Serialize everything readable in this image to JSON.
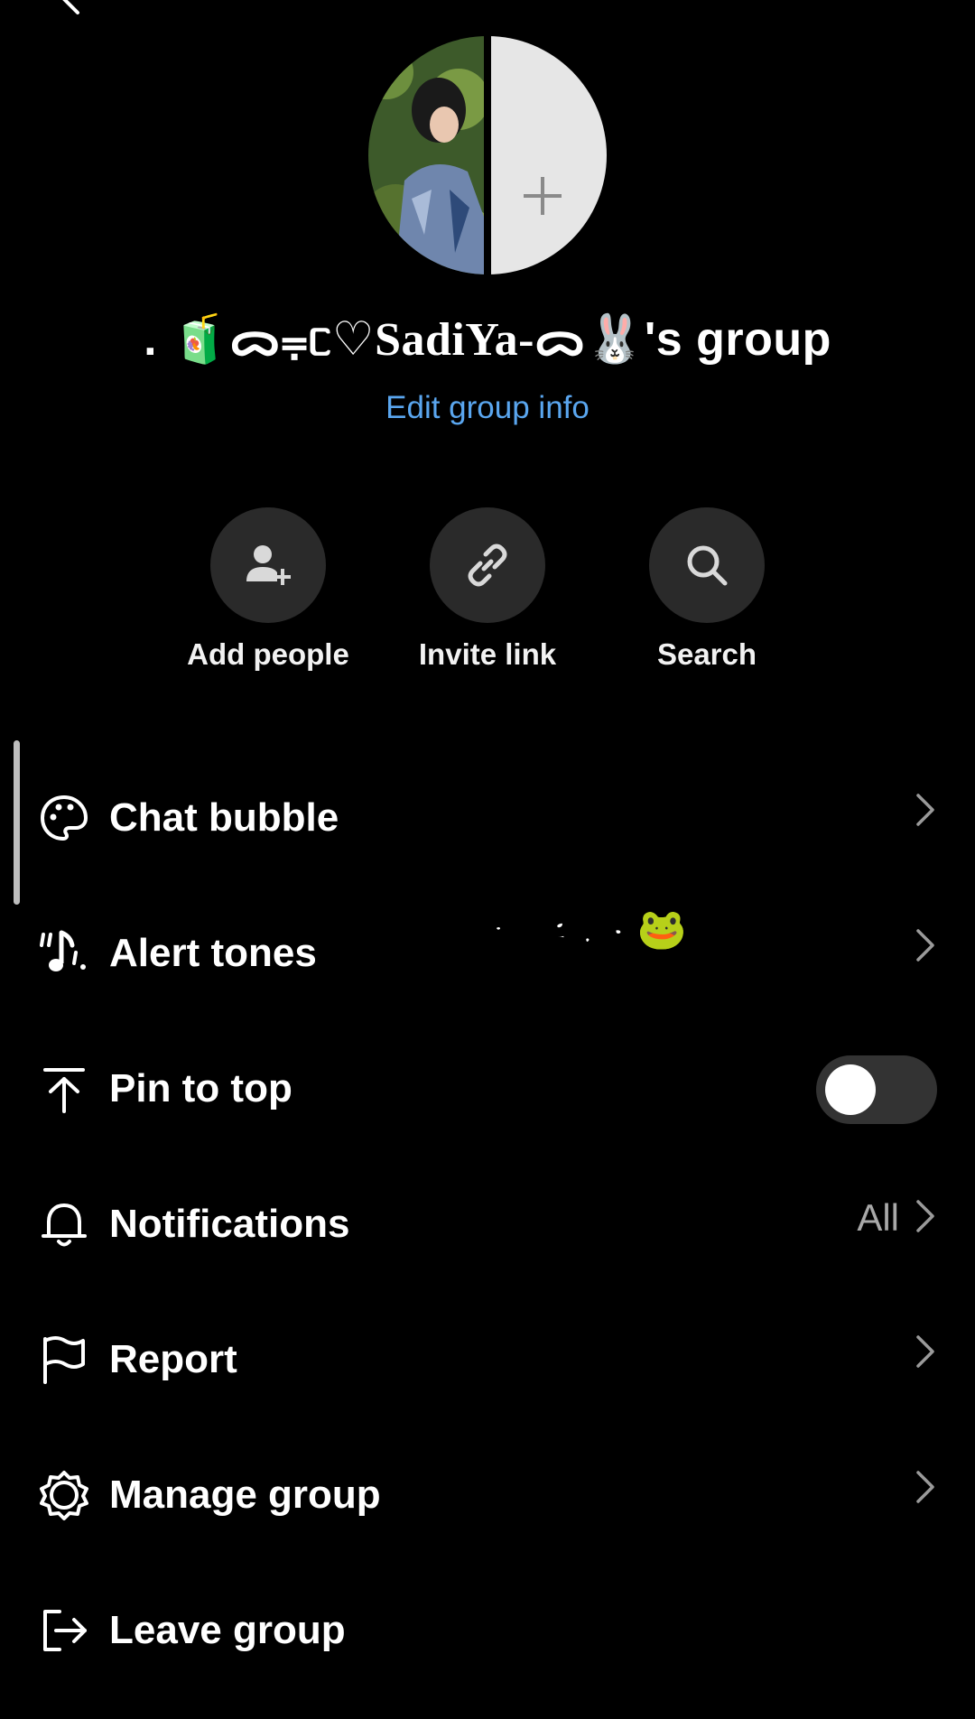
{
  "header": {
    "group_name_prefix": ". 🧃",
    "group_name_deco": "ᯅ⩦ᥴ♡",
    "group_name_core": "SadiYa-",
    "group_name_suffix": "ᯅ🐰",
    "group_name_tail": "'s group",
    "edit_label": "Edit group info"
  },
  "actions": [
    {
      "label": "Add people",
      "icon": "add-person-icon"
    },
    {
      "label": "Invite link",
      "icon": "link-icon"
    },
    {
      "label": "Search",
      "icon": "search-icon"
    }
  ],
  "menu": [
    {
      "label": "Chat bubble",
      "icon": "palette-icon"
    },
    {
      "label": "Alert tones",
      "icon": "music-note-icon"
    },
    {
      "label": "Pin to top",
      "icon": "pin-top-icon",
      "toggle_on": false
    },
    {
      "label": "Notifications",
      "icon": "bell-icon",
      "value": "All"
    },
    {
      "label": "Report",
      "icon": "flag-icon"
    },
    {
      "label": "Manage group",
      "icon": "gear-icon"
    },
    {
      "label": "Leave group",
      "icon": "leave-icon"
    }
  ],
  "overlay": {
    "text": "এড হবেন🐸"
  },
  "colors": {
    "background": "#000000",
    "accent": "#5aa6ef",
    "button_bg": "#2a2a2a",
    "toggle_off": "#333333"
  }
}
